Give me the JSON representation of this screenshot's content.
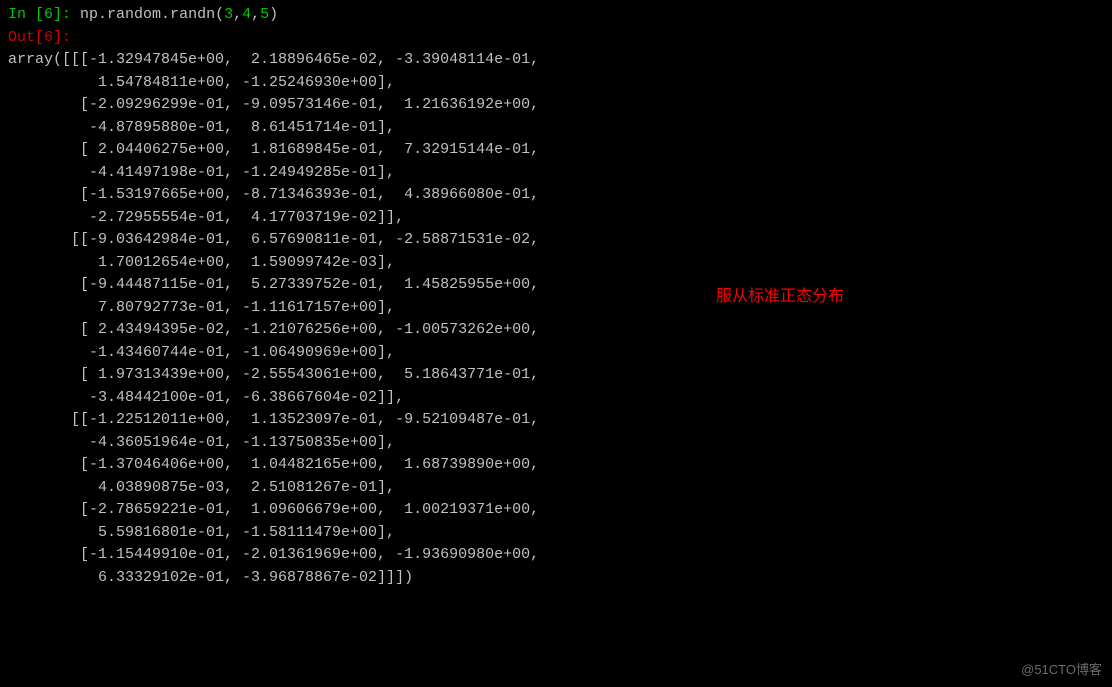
{
  "prompt": {
    "in_label": "In [",
    "in_num": "6",
    "in_close": "]: ",
    "out_label": "Out[",
    "out_num": "6",
    "out_close": "]:"
  },
  "command": {
    "prefix": "np.random.randn(",
    "arg1": "3",
    "sep1": ",",
    "arg2": "4",
    "sep2": ",",
    "arg3": "5",
    "suffix": ")"
  },
  "annotation": {
    "text": "服从标准正态分布"
  },
  "watermark": {
    "text": "@51CTO博客"
  },
  "output": {
    "lines": [
      "array([[[-1.32947845e+00,  2.18896465e-02, -3.39048114e-01,",
      "          1.54784811e+00, -1.25246930e+00],",
      "        [-2.09296299e-01, -9.09573146e-01,  1.21636192e+00,",
      "         -4.87895880e-01,  8.61451714e-01],",
      "        [ 2.04406275e+00,  1.81689845e-01,  7.32915144e-01,",
      "         -4.41497198e-01, -1.24949285e-01],",
      "        [-1.53197665e+00, -8.71346393e-01,  4.38966080e-01,",
      "         -2.72955554e-01,  4.17703719e-02]],",
      "",
      "       [[-9.03642984e-01,  6.57690811e-01, -2.58871531e-02,",
      "          1.70012654e+00,  1.59099742e-03],",
      "        [-9.44487115e-01,  5.27339752e-01,  1.45825955e+00,",
      "          7.80792773e-01, -1.11617157e+00],",
      "        [ 2.43494395e-02, -1.21076256e+00, -1.00573262e+00,",
      "         -1.43460744e-01, -1.06490969e+00],",
      "        [ 1.97313439e+00, -2.55543061e+00,  5.18643771e-01,",
      "         -3.48442100e-01, -6.38667604e-02]],",
      "",
      "       [[-1.22512011e+00,  1.13523097e-01, -9.52109487e-01,",
      "         -4.36051964e-01, -1.13750835e+00],",
      "        [-1.37046406e+00,  1.04482165e+00,  1.68739890e+00,",
      "          4.03890875e-03,  2.51081267e-01],",
      "        [-2.78659221e-01,  1.09606679e+00,  1.00219371e+00,",
      "          5.59816801e-01, -1.58111479e+00],",
      "        [-1.15449910e-01, -2.01361969e+00, -1.93690980e+00,",
      "          6.33329102e-01, -3.96878867e-02]]])"
    ]
  },
  "chart_data": {
    "type": "table",
    "title": "np.random.randn(3,4,5) output - 3D array",
    "shape": [
      3,
      4,
      5
    ],
    "data": [
      [
        [
          -1.32947845,
          0.0218896465,
          -0.339048114,
          1.54784811,
          -1.2524693
        ],
        [
          -0.209296299,
          -0.909573146,
          1.21636192,
          -0.48789588,
          0.861451714
        ],
        [
          2.04406275,
          0.181689845,
          0.732915144,
          -0.441497198,
          -0.124949285
        ],
        [
          -1.53197665,
          -0.871346393,
          0.43896608,
          -0.272955554,
          0.0417703719
        ]
      ],
      [
        [
          -0.903642984,
          0.657690811,
          -0.0258871531,
          1.70012654,
          0.00159099742
        ],
        [
          -0.944487115,
          0.527339752,
          1.45825955,
          0.780792773,
          -1.11617157
        ],
        [
          0.0243494395,
          -1.21076256,
          -1.00573262,
          -0.143460744,
          -1.06490969
        ],
        [
          1.97313439,
          -2.55543061,
          0.518643771,
          -0.3484421,
          -0.0638667604
        ]
      ],
      [
        [
          -1.22512011,
          0.113523097,
          -0.952109487,
          -0.436051964,
          -1.13750835
        ],
        [
          -1.37046406,
          1.04482165,
          1.6873989,
          0.00403890875,
          0.251081267
        ],
        [
          -0.278659221,
          1.09606679,
          1.00219371,
          0.559816801,
          -1.58111479
        ],
        [
          -0.11544991,
          -2.01361969,
          -1.9369098,
          0.633329102,
          -0.0396878867
        ]
      ]
    ]
  }
}
